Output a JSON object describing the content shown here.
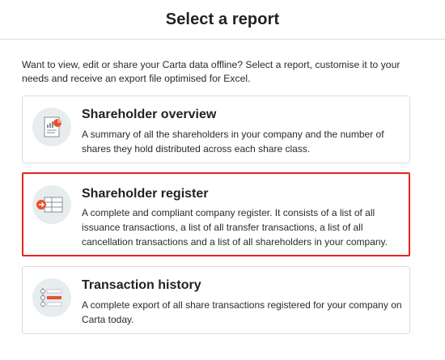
{
  "header": {
    "title": "Select a report"
  },
  "intro": {
    "text": "Want to view, edit or share your Carta data offline? Select a report, customise it to your needs and receive an export file optimised for Excel."
  },
  "reports": [
    {
      "title": "Shareholder overview",
      "description": "A summary of all the shareholders in your company and the number of shares they hold distributed across each share class.",
      "icon": "document-chart-icon",
      "selected": false
    },
    {
      "title": "Shareholder register",
      "description": "A complete and compliant company register. It consists of a list of all issuance transactions, a list of all transfer transactions, a list of all cancellation transactions and a list of all shareholders in your company.",
      "icon": "register-table-icon",
      "selected": true
    },
    {
      "title": "Transaction history",
      "description": "A complete export of all share transactions registered for your company on Carta today.",
      "icon": "timeline-icon",
      "selected": false
    }
  ],
  "colors": {
    "accent": "#e8522a",
    "selected_border": "#e32420",
    "icon_bg": "#e7ecef"
  }
}
